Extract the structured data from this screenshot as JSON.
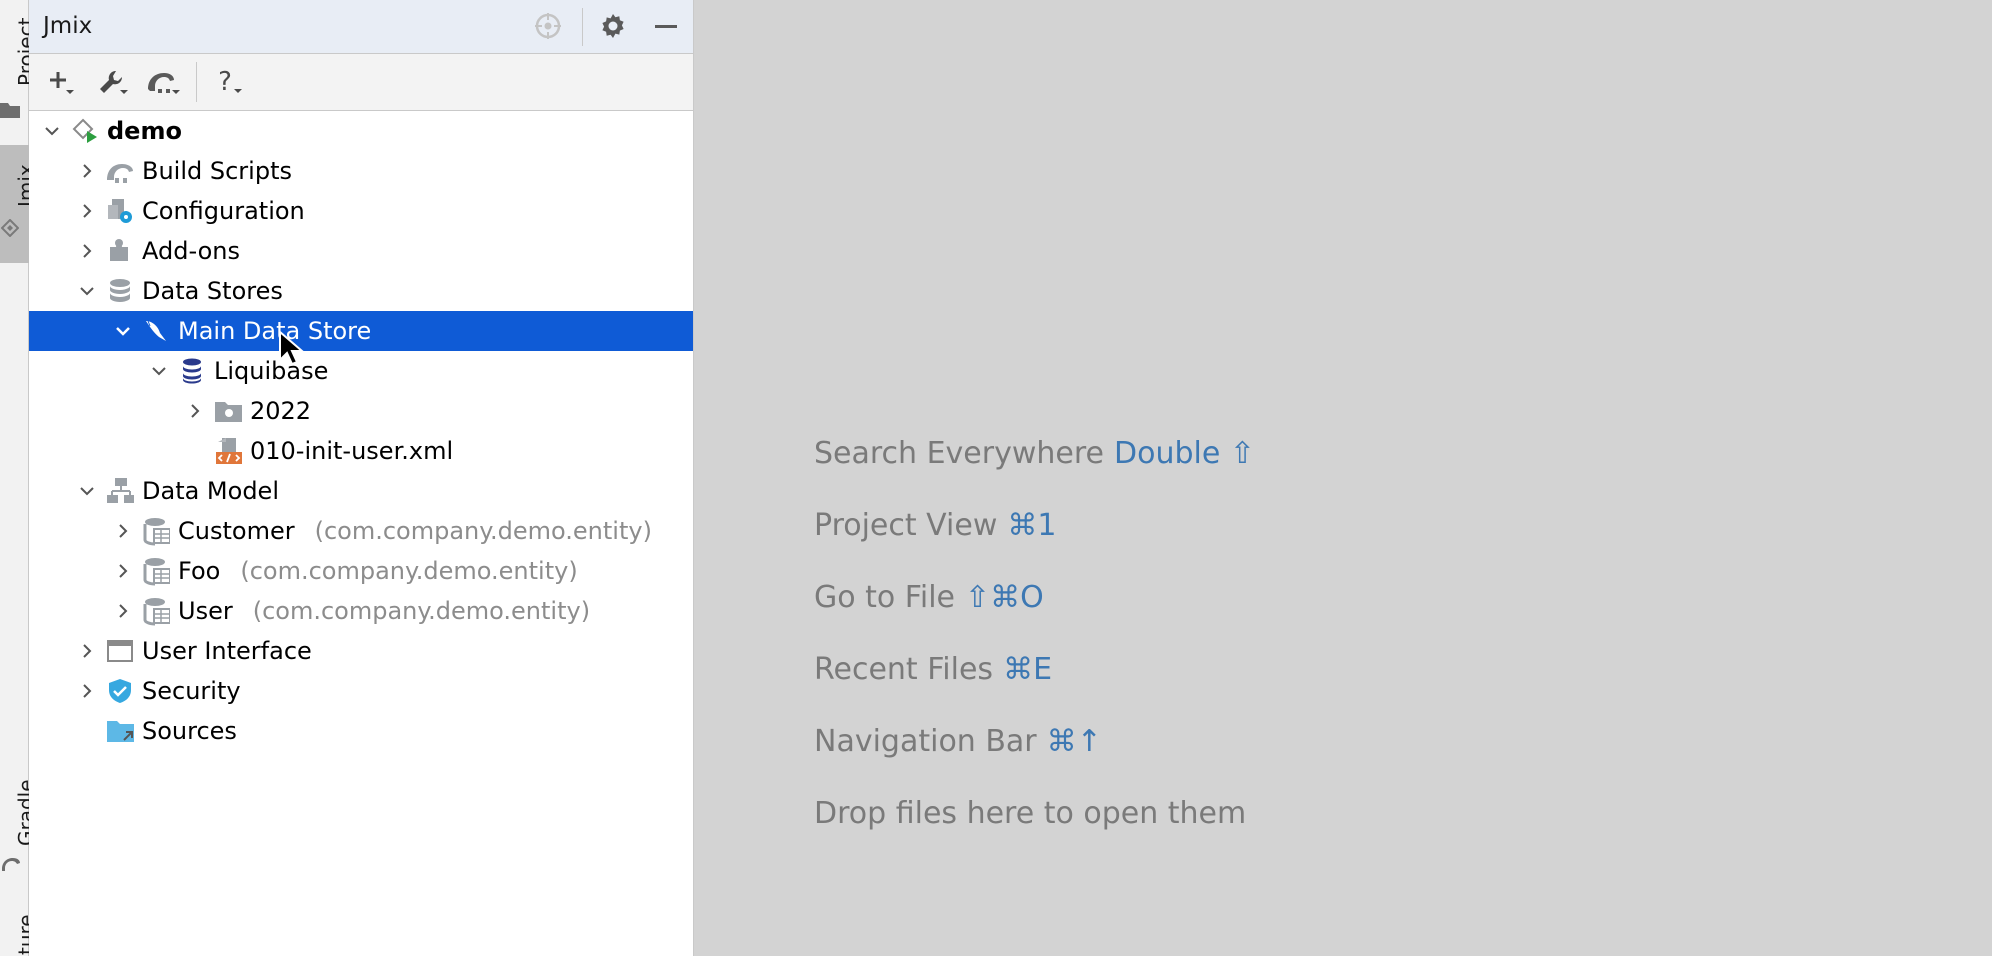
{
  "side_strip": {
    "tabs": [
      {
        "label": "Project"
      },
      {
        "label": "Jmix"
      },
      {
        "label": "Gradle"
      },
      {
        "label": "ture"
      }
    ]
  },
  "panel": {
    "title": "Jmix",
    "toolbar": {
      "buttons": [
        "add-icon",
        "wrench-icon",
        "gradle-elephant-icon",
        "help-icon"
      ],
      "help_label": "?"
    }
  },
  "tree": [
    {
      "label": "demo",
      "bold": true,
      "expanded": true,
      "icon": "jmix-project-icon"
    },
    {
      "label": "Build Scripts",
      "expanded": false,
      "icon": "gradle-elephant-icon"
    },
    {
      "label": "Configuration",
      "expanded": false,
      "icon": "configuration-icon"
    },
    {
      "label": "Add-ons",
      "expanded": false,
      "icon": "puzzle-icon"
    },
    {
      "label": "Data Stores",
      "expanded": true,
      "icon": "database-icon"
    },
    {
      "label": "Main Data Store",
      "expanded": true,
      "selected": true,
      "icon": "mysql-dolphin-icon"
    },
    {
      "label": "Liquibase",
      "expanded": true,
      "icon": "liquibase-icon"
    },
    {
      "label": "2022",
      "expanded": false,
      "icon": "folder-icon"
    },
    {
      "label": "010-init-user.xml",
      "icon": "xml-file-icon"
    },
    {
      "label": "Data Model",
      "expanded": true,
      "icon": "data-model-icon"
    },
    {
      "label": "Customer",
      "package": "(com.company.demo.entity)",
      "expanded": false,
      "icon": "entity-icon"
    },
    {
      "label": "Foo",
      "package": "(com.company.demo.entity)",
      "expanded": false,
      "icon": "entity-icon"
    },
    {
      "label": "User",
      "package": "(com.company.demo.entity)",
      "expanded": false,
      "icon": "entity-icon"
    },
    {
      "label": "User Interface",
      "expanded": false,
      "icon": "window-icon"
    },
    {
      "label": "Security",
      "expanded": false,
      "icon": "shield-icon"
    },
    {
      "label": "Sources",
      "icon": "source-folder-icon"
    }
  ],
  "editor_hints": [
    {
      "text": "Search Everywhere",
      "shortcut": "Double ⇧"
    },
    {
      "text": "Project View",
      "shortcut": "⌘1"
    },
    {
      "text": "Go to File",
      "shortcut": "⇧⌘O"
    },
    {
      "text": "Recent Files",
      "shortcut": "⌘E"
    },
    {
      "text": "Navigation Bar",
      "shortcut": "⌘↑"
    },
    {
      "text": "Drop files here to open them",
      "shortcut": ""
    }
  ],
  "colors": {
    "selection": "#0f5bd6",
    "shortcut": "#3d78b3",
    "hint_text": "#7a7a7a",
    "package_text": "#8c8c8c"
  }
}
